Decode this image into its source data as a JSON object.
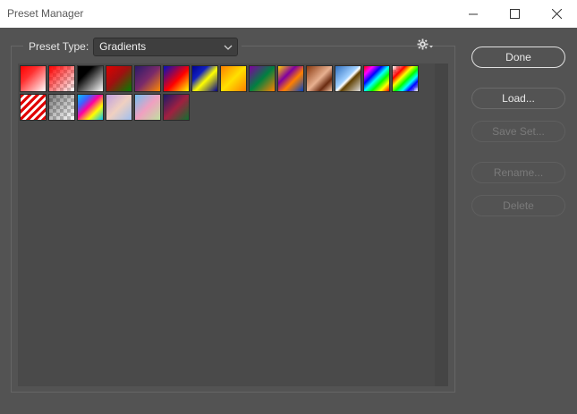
{
  "window": {
    "title": "Preset Manager"
  },
  "preset_type": {
    "label": "Preset Type:",
    "selected": "Gradients"
  },
  "icons": {
    "settings": "gear-icon",
    "dropdown": "chevron-down-icon"
  },
  "buttons": {
    "done": "Done",
    "load": "Load...",
    "save_set": "Save Set...",
    "rename": "Rename...",
    "delete": "Delete"
  },
  "gradients": [
    {
      "name": "red-white",
      "css": "linear-gradient(135deg,#ff0000 0%,#ff3030 35%,#ffffff 100%)",
      "checker": false
    },
    {
      "name": "red-transparent",
      "css": "linear-gradient(135deg,#ff0000 0%,rgba(255,0,0,0.6) 40%,rgba(255,0,0,0) 100%)",
      "checker": true
    },
    {
      "name": "black-white",
      "css": "linear-gradient(135deg,#000000 0%,#000000 30%,#ffffff 100%)",
      "checker": false
    },
    {
      "name": "red-green",
      "css": "linear-gradient(135deg,#e00000 0%,#a01010 45%,#008000 100%)",
      "checker": false
    },
    {
      "name": "violet-orange",
      "css": "linear-gradient(135deg,#2a1a6a 0%,#7a2a6a 50%,#ff8a00 100%)",
      "checker": false
    },
    {
      "name": "blue-red-yellow",
      "css": "linear-gradient(135deg,#0010c0 0%,#ff0000 55%,#ffff00 100%)",
      "checker": false
    },
    {
      "name": "blue-yellow-blue",
      "css": "linear-gradient(135deg,#000090 0%,#1020c0 30%,#ffff00 55%,#000090 100%)",
      "checker": false
    },
    {
      "name": "orange-yellow-orange",
      "css": "linear-gradient(135deg,#ff8000 0%,#ffe000 50%,#ff8000 100%)",
      "checker": false
    },
    {
      "name": "violet-green-orange",
      "css": "linear-gradient(135deg,#8000a0 0%,#008040 50%,#ff8000 100%)",
      "checker": false
    },
    {
      "name": "yellow-violet-orange-blue",
      "css": "linear-gradient(135deg,#ffd000 0%,#8000a0 35%,#ff8000 60%,#0040c0 100%)",
      "checker": false
    },
    {
      "name": "copper",
      "css": "linear-gradient(135deg,#8a3a10 0%,#e8b090 50%,#6a2a10 75%,#f0c0a0 100%)",
      "checker": false
    },
    {
      "name": "chrome",
      "css": "linear-gradient(135deg,#3070c0 0%,#a0d0ff 45%,#ffffff 52%,#604000 60%,#e0e0e0 100%)",
      "checker": false
    },
    {
      "name": "spectrum",
      "css": "linear-gradient(135deg,#ff0000 0%,#ff00ff 18%,#0000ff 35%,#00ffff 50%,#00ff00 65%,#ffff00 82%,#ff0000 100%)",
      "checker": false
    },
    {
      "name": "transparent-rainbow",
      "css": "linear-gradient(135deg,rgba(255,0,0,0) 0%,#ff0000 25%,#ffff00 40%,#00ff00 55%,#00ffff 68%,#0000ff 80%,rgba(255,0,255,0) 100%)",
      "checker": true
    },
    {
      "name": "transparent-stripes",
      "css": "repeating-linear-gradient(135deg,#e00000 0px,#e00000 3px,#ffffff 3px,#ffffff 6px)",
      "checker": false
    },
    {
      "name": "neutral-density",
      "css": "linear-gradient(135deg,rgba(0,0,0,0.5) 0%,rgba(0,0,0,0) 100%)",
      "checker": true
    },
    {
      "name": "sunset-rainbow",
      "css": "linear-gradient(135deg,#00c0ff 0%,#4060ff 25%,#ff00a0 45%,#ffff00 70%,#00c0ff 100%)",
      "checker": false
    },
    {
      "name": "pastel",
      "css": "linear-gradient(135deg,#c0a0e0 0%,#f0d0c0 50%,#a0c0f0 100%)",
      "checker": false
    },
    {
      "name": "pastel-2",
      "css": "linear-gradient(135deg,#70c0f0 0%,#f0a0c0 50%,#c0e0a0 100%)",
      "checker": false
    },
    {
      "name": "dark-green-red",
      "css": "linear-gradient(135deg,#1a1a6a 0%,#a02040 50%,#107030 100%)",
      "checker": false
    }
  ]
}
